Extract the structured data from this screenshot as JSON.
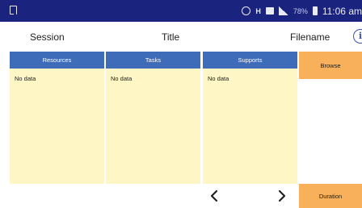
{
  "status_bar": {
    "battery_percent": "78%",
    "time": "11:06 am",
    "icons": [
      "notification-icon",
      "alarm-icon",
      "h-network-icon",
      "message-icon",
      "signal-icon",
      "battery-icon"
    ]
  },
  "header": {
    "session": "Session",
    "title": "Title",
    "filename": "Filename",
    "info_glyph": "i"
  },
  "columns": [
    {
      "header": "Resources",
      "empty_text": "No data"
    },
    {
      "header": "Tasks",
      "empty_text": "No data"
    },
    {
      "header": "Supports",
      "empty_text": "No data"
    }
  ],
  "buttons": {
    "browse": "Browse",
    "duration": "Duration"
  },
  "colors": {
    "status_bar": "#1a237e",
    "column_header": "#3f6cb8",
    "column_body": "#fef6c4",
    "button": "#f8b15a"
  }
}
